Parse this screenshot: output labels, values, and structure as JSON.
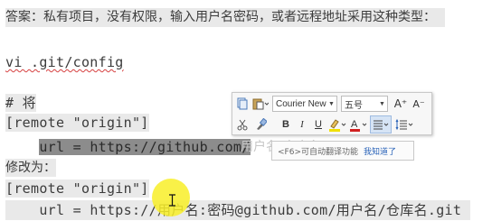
{
  "document": {
    "answer_line": "答案：私有项目，没有权限，输入用户名密码，或者远程地址采用这种类型：",
    "cmd_line": "vi .git/config",
    "comment_line": "# 将",
    "remote_line_1": "[remote \"origin\"]",
    "url_line_selected": "url = https://github.com/",
    "url_line_ghost": "用户名/仓库名.git",
    "change_to": "修改为：",
    "remote_line_2": "[remote \"origin\"]",
    "url_line_new_prefix": "url = https://",
    "url_line_new_rest": "用户名:密码@github.com/用户名/仓库名.git"
  },
  "toolbar": {
    "font_name": "Courier New",
    "font_size": "五号",
    "grow_font": "A⁺",
    "shrink_font": "A⁻",
    "bold": "B",
    "italic": "I",
    "underline": "U",
    "font_color": "A"
  },
  "tooltip": {
    "text": "<F6>可自动翻译功能",
    "link": "我知道了"
  },
  "colors": {
    "selection": "#8c8c8c",
    "highlight_cursor": "#f8ee28",
    "tooltip_link": "#2a63b8"
  }
}
